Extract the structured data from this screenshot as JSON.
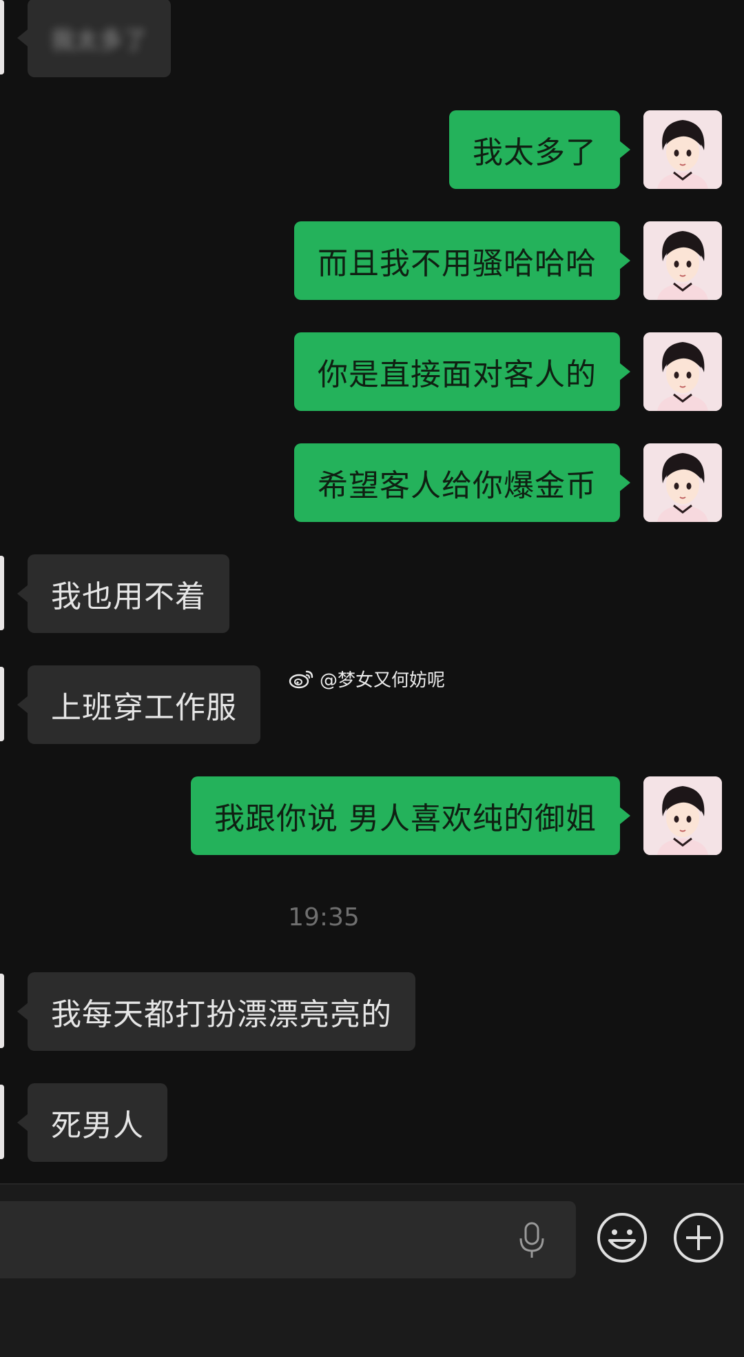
{
  "messages": [
    {
      "side": "in",
      "text": "我太多了",
      "blurred": true
    },
    {
      "side": "out",
      "text": "我太多了"
    },
    {
      "side": "out",
      "text": "而且我不用骚哈哈哈"
    },
    {
      "side": "out",
      "text": "你是直接面对客人的"
    },
    {
      "side": "out",
      "text": "希望客人给你爆金币"
    },
    {
      "side": "in",
      "text": "我也用不着"
    },
    {
      "side": "in",
      "text": "上班穿工作服"
    },
    {
      "side": "out",
      "text": "我跟你说 男人喜欢纯的御姐"
    },
    {
      "side": "in",
      "text": "我每天都打扮漂漂亮亮的"
    },
    {
      "side": "in",
      "text": "死男人"
    }
  ],
  "timestamp": "19:35",
  "watermark": "@梦女又何妨呢",
  "input": {
    "placeholder": "",
    "mic_icon": "microphone-icon",
    "emoji_icon": "emoji-icon",
    "plus_icon": "plus-icon"
  },
  "colors": {
    "background": "#111111",
    "bubble_out": "#24b25b",
    "bubble_in": "#2c2c2c"
  }
}
